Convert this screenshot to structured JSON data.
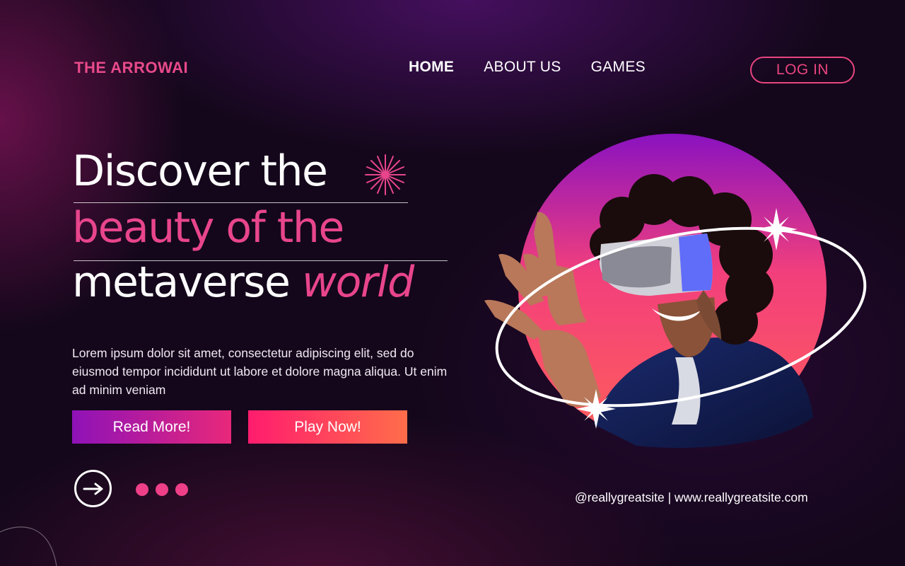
{
  "brand": {
    "name": "THE ARROWAI"
  },
  "nav": {
    "items": [
      {
        "label": "HOME",
        "active": true
      },
      {
        "label": "ABOUT US",
        "active": false
      },
      {
        "label": "GAMES",
        "active": false
      }
    ],
    "login_label": "LOG IN"
  },
  "hero": {
    "line1": "Discover the",
    "line2": "beauty of the",
    "line3": "metaverse",
    "line3_accent": "world",
    "description": "Lorem ipsum dolor sit amet, consectetur adipiscing elit, sed do eiusmod tempor incididunt ut labore et dolore magna aliqua. Ut enim ad minim veniam",
    "read_more_label": "Read More!",
    "play_now_label": "Play Now!"
  },
  "footer": {
    "links": "@reallygreatsite | www.reallygreatsite.com"
  },
  "icons": {
    "next": "arrow-right-icon",
    "sparkle": "sparkle-burst-icon",
    "pagination": "dots-indicator"
  },
  "colors": {
    "background": "#14071b",
    "accent_pink": "#e8458c",
    "read_more_gradient": [
      "#8e12b8",
      "#e8287a"
    ],
    "play_now_gradient": [
      "#ff1c6e",
      "#ff6d4a"
    ],
    "hero_circle_gradient": [
      "#8a12c0",
      "#f23f7c",
      "#ff5e5a"
    ]
  }
}
